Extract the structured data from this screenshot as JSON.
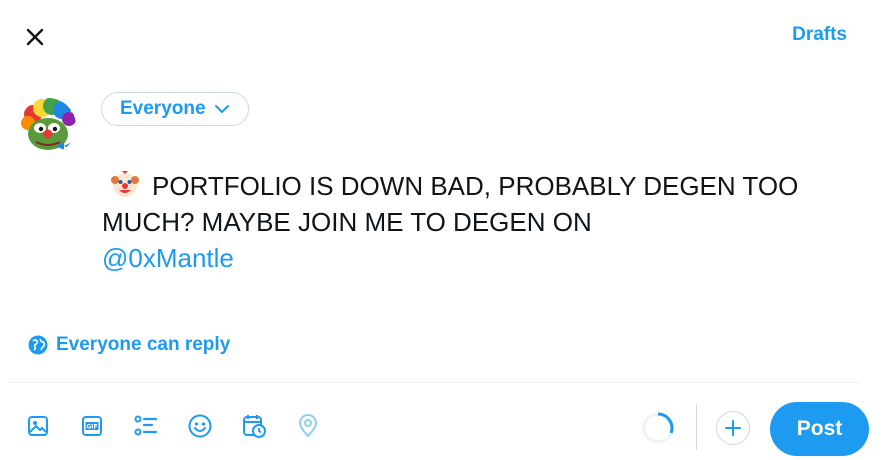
{
  "header": {
    "close_icon": "close-icon",
    "drafts_label": "Drafts"
  },
  "audience": {
    "label": "Everyone",
    "icon": "chevron-down-icon"
  },
  "compose": {
    "emoji": "clown-face-emoji",
    "text": "PORTFOLIO IS DOWN BAD, PROBABLY DEGEN TOO MUCH? MAYBE JOIN ME TO DEGEN ON",
    "mention": "@0xMantle"
  },
  "reply_setting": {
    "icon": "globe-icon",
    "label": "Everyone can reply"
  },
  "toolbar": {
    "tools": [
      "image-icon",
      "gif-icon",
      "poll-icon",
      "emoji-icon",
      "schedule-icon",
      "location-icon"
    ],
    "add_icon": "plus-icon",
    "post_label": "Post"
  },
  "colors": {
    "accent": "#1d9bf0",
    "text": "#0f1419",
    "border": "#cfd9de"
  }
}
